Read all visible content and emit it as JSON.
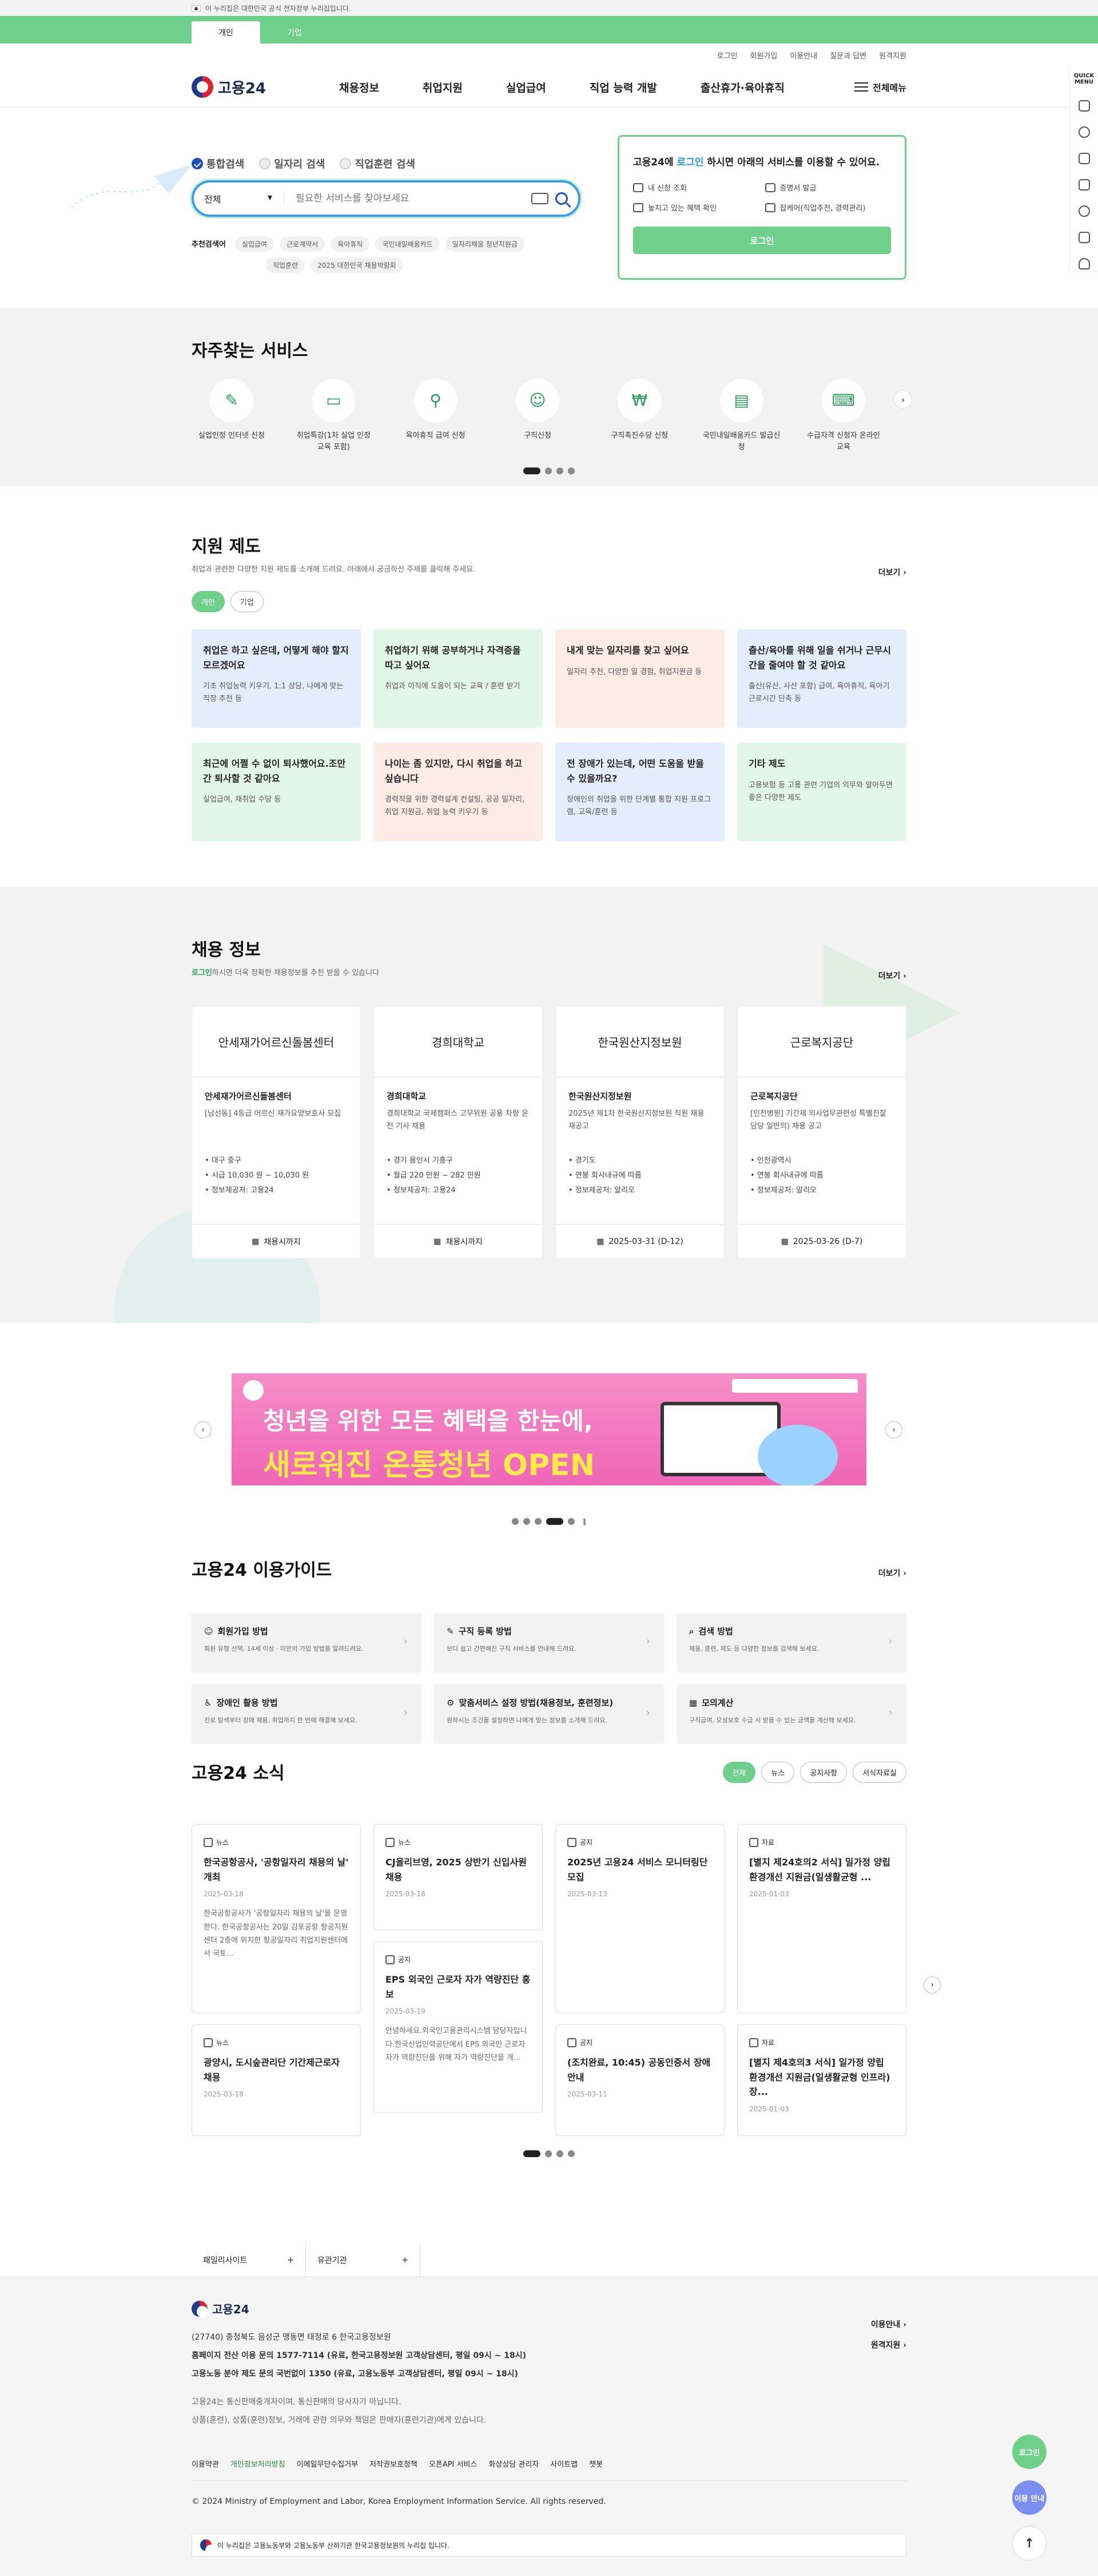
{
  "gov_banner": "이 누리집은 대한민국 공식 전자정부 누리집입니다.",
  "portal_tabs": [
    "개인",
    "기업"
  ],
  "util_links": [
    "로그인",
    "회원가입",
    "이용안내",
    "질문과 답변",
    "원격지원"
  ],
  "logo": "고용24",
  "gnb": [
    "채용정보",
    "취업지원",
    "실업급여",
    "직업 능력 개발",
    "출산휴가·육아휴직"
  ],
  "all_menu": "전체메뉴",
  "search": {
    "tabs": [
      "통합검색",
      "일자리 검색",
      "직업훈련 검색"
    ],
    "select": "전체",
    "placeholder": "필요한 서비스를 찾아보세요",
    "keyword_label": "추천검색어",
    "keywords": [
      "실업급여",
      "근로계약서",
      "육아휴직",
      "국민내일배움카드",
      "일자리채움 청년지원금",
      "직업훈련",
      "2025 대한민국 채용박람회"
    ]
  },
  "login_card": {
    "pre": "고용24에 ",
    "accent": "로그인",
    "post": " 하시면 아래의 서비스를 이용할 수 있어요.",
    "items": [
      "내 신청 조회",
      "증명서 발급",
      "놓치고 있는 혜택 확인",
      "잡케어(직업추천, 경력관리)"
    ],
    "button": "로그인"
  },
  "freq": {
    "title": "자주찾는 서비스",
    "items": [
      {
        "icon": "✎",
        "label": "실업인정 인터넷 신청"
      },
      {
        "icon": "▭",
        "label": "취업특강(1차 실업 인정교육 포함)"
      },
      {
        "icon": "⚲",
        "label": "육아휴직 급여 신청"
      },
      {
        "icon": "☺",
        "label": "구직신청"
      },
      {
        "icon": "₩",
        "label": "구직촉진수당 신청"
      },
      {
        "icon": "▤",
        "label": "국민내일배움카드 발급신청"
      },
      {
        "icon": "⌨",
        "label": "수급자격 신청자 온라인 교육"
      }
    ]
  },
  "support": {
    "title": "지원 제도",
    "desc": "취업과 관련한 다양한 지원 제도를 소개해 드려요. 아래에서 궁금하신 주제를 클릭해 주세요.",
    "more": "더보기",
    "tabs": [
      "개인",
      "기업"
    ],
    "cards": [
      {
        "t": "취업은 하고 싶은데, 어떻게 해야 할지 모르겠어요",
        "d": "기초 취업능력 키우기, 1:1 상담, 나에게 맞는 직장 추천 등",
        "c": "blue"
      },
      {
        "t": "취업하기 위해 공부하거나 자격증을 따고 싶어요",
        "d": "취업과 이직에 도움이 되는 교육 / 훈련 받기",
        "c": "green"
      },
      {
        "t": "내게 맞는 일자리를 찾고 싶어요",
        "d": "일자리 추천, 다양한 일 경험, 취업지원금 등",
        "c": "pink"
      },
      {
        "t": "출산/육아를 위해 일을 쉬거나 근무시간을 줄여야 할 것 같아요",
        "d": "출산(유산, 사산 포함) 급여, 육아휴직, 육아기 근로시간 단축 등",
        "c": "blue"
      },
      {
        "t": "최근에 어쩔 수 없이 퇴사했어요.조만간 퇴사할 것 같아요",
        "d": "실업급여, 재취업 수당 등",
        "c": "green"
      },
      {
        "t": "나이는 좀 있지만, 다시 취업을 하고 싶습니다",
        "d": "경력직을 위한 경력설계 컨설팅, 공공 일자리, 취업 지원금, 취업 능력 키우기 등",
        "c": "pink"
      },
      {
        "t": "전 장애가 있는데, 어떤 도움을 받을 수 있을까요?",
        "d": "장애인의 취업을 위한 단계별 통합 지원 프로그램, 교육/훈련 등",
        "c": "blue"
      },
      {
        "t": "기타 제도",
        "d": "고용보험 등 고용 관련 기업의 의무와 알아두면 좋은 다양한 제도",
        "c": "green"
      }
    ]
  },
  "jobs": {
    "title": "채용 정보",
    "desc_accent": "로그인",
    "desc": "하시면 더욱 정확한 채용정보를 추천 받을 수 있습니다",
    "more": "더보기",
    "cards": [
      {
        "org": "안세재가어르신돌봄센터",
        "name": "안세재가어르신돌봄센터",
        "desc": "[남선동] 4등급 어르신 재가요양보호사 모집",
        "items": [
          "대구 중구",
          "시급 10,030 원 ~ 10,030 원",
          "정보제공처: 고용24"
        ],
        "foot": "채용시까지"
      },
      {
        "org": "경희대학교",
        "name": "경희대학교",
        "desc": "경희대학교 국제캠퍼스 고무위원 공용 차량 운전 기사 채용",
        "items": [
          "경기 용인시 기흥구",
          "월급 220 만원 ~ 282 만원",
          "정보제공처: 고용24"
        ],
        "foot": "채용시까지"
      },
      {
        "org": "한국원산지정보원",
        "name": "한국원산지정보원",
        "desc": "2025년 제1차 한국원산지정보원 직원 채용 재공고",
        "items": [
          "경기도",
          "연봉 회사내규에 따름",
          "정보제공처: 알리오"
        ],
        "foot": "2025-03-31 (D-12)"
      },
      {
        "org": "근로복지공단",
        "name": "근로복지공단",
        "desc": "[인천병원] 기간제 의사업무관련성 특별진찰 담당 일반의) 채용 공고",
        "items": [
          "인천광역시",
          "연봉 회사내규에 따름",
          "정보제공처: 알리오"
        ],
        "foot": "2025-03-26 (D-7)"
      }
    ]
  },
  "banner": {
    "line1": "청년을 위한 모든 혜택을 한눈에,",
    "line2": "새로워진 온통청년 OPEN"
  },
  "guide": {
    "title": "고용24 이용가이드",
    "more": "더보기",
    "items": [
      {
        "t": "회원가입 방법",
        "d": "회원 유형 선택, 14세 이상 · 미만의 가입 방법을 알려드려요."
      },
      {
        "t": "구직 등록 방법",
        "d": "보다 쉽고 간편해진 구직 서비스를 안내해 드려요."
      },
      {
        "t": "검색 방법",
        "d": "채용, 훈련, 제도 등 다양한 정보를 검색해 보세요."
      },
      {
        "t": "장애인 활용 방법",
        "d": "진로 탐색부터 장애 채용, 취업까지 한 번에 해결해 보세요."
      },
      {
        "t": "맞춤서비스 설정 방법(채용정보, 훈련정보)",
        "d": "원하시는 조건을 설정하면 나에게 맞는 정보를 소개해 드려요."
      },
      {
        "t": "모의계산",
        "d": "구직급여, 모성보호 수급 시 받을 수 있는 금액을 계산해 보세요."
      }
    ]
  },
  "news": {
    "title": "고용24 소식",
    "tabs": [
      "전체",
      "뉴스",
      "공지사항",
      "서식자료실"
    ],
    "cols": [
      [
        {
          "tag": "뉴스",
          "t": "한국공항공사, '공항일자리 채용의 날' 개최",
          "d": "2025-03-18",
          "p": "한국공항공사가 '공항일자리 채용의 날'을 운영한다. 한국공항공사는 20일 김포공항 항공지원센터 2층에 위치한 항공일자리 취업지원센터에서 국토..."
        },
        {
          "tag": "뉴스",
          "t": "광양시, 도시숲관리단 기간제근로자 채용",
          "d": "2025-03-18",
          "p": ""
        }
      ],
      [
        {
          "tag": "뉴스",
          "t": "CJ올리브영, 2025 상반기 신입사원 채용",
          "d": "2025-03-18",
          "p": ""
        },
        {
          "tag": "공지",
          "t": "EPS 외국인 근로자 자가 역량진단 홍보",
          "d": "2025-03-19",
          "p": "안녕하세요.외국인고용관리시스템 담당자입니다.한국산업인력공단에서 EPS 외국인 근로자 자가 역량진단을 위해 자가 역량진단을 개..."
        }
      ],
      [
        {
          "tag": "공지",
          "t": "2025년 고용24 서비스 모니터링단 모집",
          "d": "2025-03-13",
          "p": ""
        },
        {
          "tag": "공지",
          "t": "(조치완료, 10:45) 공동인증서 장애 안내",
          "d": "2025-03-11",
          "p": ""
        }
      ],
      [
        {
          "tag": "자료",
          "t": "[별지 제24호의2 서식] 일가정 양립 환경개선 지원금(일생활균형 ...",
          "d": "2025-01-03",
          "p": ""
        },
        {
          "tag": "자료",
          "t": "[별지 제4호의3 서식] 일가정 양립 환경개선 지원금(일생활균형 인프라) 장...",
          "d": "2025-01-03",
          "p": ""
        }
      ]
    ]
  },
  "footer": {
    "selects": [
      "패밀리사이트",
      "유관기관"
    ],
    "logo": "고용24",
    "addr": "(27740) 충청북도 음성군 맹동면 태정로 6 한국고용정보원",
    "lines": [
      "홈페이지 전산 이용 문의 1577-7114 (유료, 한국고용정보원 고객상담센터, 평일 09시 ~ 18시)",
      "고용노동 분야 제도 문의 국번없이 1350 (유료, 고용노동부 고객상담센터, 평일 09시 ~ 18시)",
      "고용24는 통신판매중개자이며, 통신판매의 당사자가 아닙니다.",
      "상품(훈련), 상품(훈련)정보, 거래에 관한 의무와 책임은 판매자(훈련기관)에게 있습니다."
    ],
    "right": [
      "이용안내",
      "원격지원"
    ],
    "links": [
      "이용약관",
      "개인정보처리방침",
      "이메일무단수집거부",
      "저작권보호정책",
      "오픈API 서비스",
      "화상상담 관리자",
      "사이트맵",
      "챗봇"
    ],
    "copy": "© 2024 Ministry of Employment and Labor, Korea Employment Information Service. All rights reserved.",
    "sign": "이 누리집은 고용노동부와 고용노동부 산하기관 한국고용정보원의 누리집 입니다."
  },
  "quick": {
    "label": "QUICK MENU"
  },
  "float": {
    "login": "로그인",
    "guide": "이용 안내",
    "top": "↑"
  }
}
